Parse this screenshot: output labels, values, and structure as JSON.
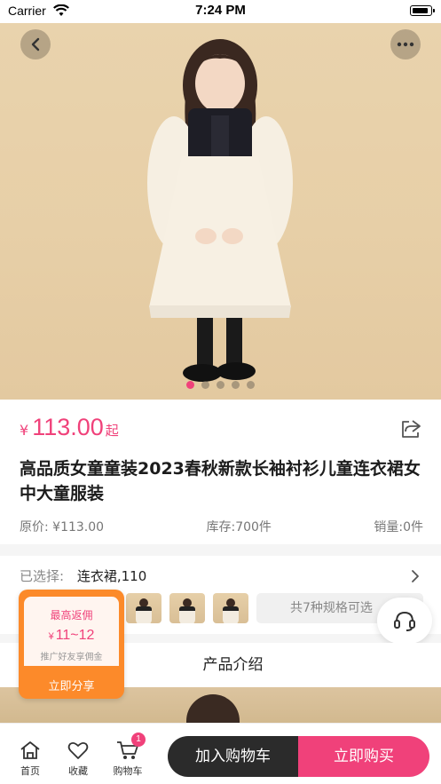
{
  "status_bar": {
    "carrier": "Carrier",
    "time": "7:24 PM"
  },
  "hero": {
    "image_description_icon": "child-dress-photo",
    "slide_count": 5,
    "active_slide": 1
  },
  "product": {
    "currency": "¥",
    "price": "113.00",
    "price_suffix": "起",
    "title": "高品质女童童装2023春秋新款长袖衬衫儿童连衣裙女中大童服装",
    "original_price": "原价: ¥113.00",
    "stock": "库存:700件",
    "sales": "销量:0件"
  },
  "selection": {
    "label": "已选择:",
    "value": "连衣裙,110",
    "spec_count_text": "共7种规格可选"
  },
  "commission": {
    "title": "最高返佣",
    "currency": "¥",
    "range": "11~12",
    "note": "推广好友享佣金",
    "share_label": "立即分享"
  },
  "intro": {
    "heading": "产品介绍"
  },
  "bottom_bar": {
    "home_label": "首页",
    "fav_label": "收藏",
    "cart_label": "购物车",
    "cart_badge": "1",
    "add_to_cart": "加入购物车",
    "buy_now": "立即购买"
  },
  "colors": {
    "accent": "#f0417a",
    "dark": "#2b2b2b",
    "orange": "#fc8a2a"
  }
}
